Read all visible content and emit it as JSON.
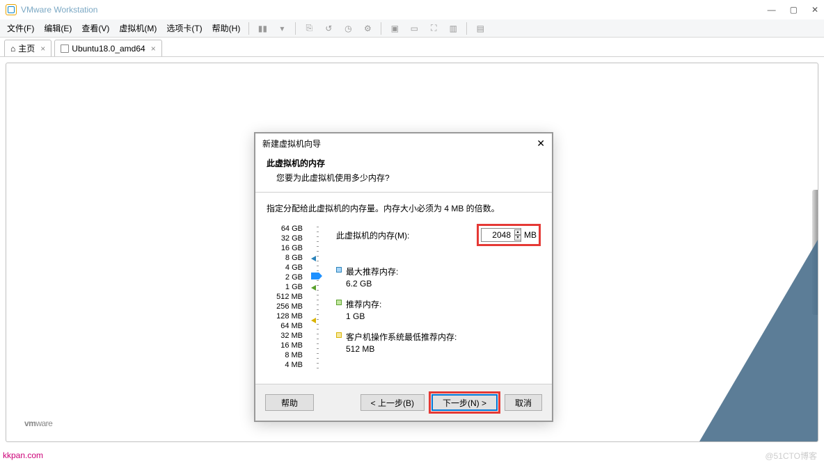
{
  "window": {
    "title": "VMware Workstation"
  },
  "win_btns": {
    "min": "—",
    "max": "▢",
    "close": "✕"
  },
  "menu": {
    "file": "文件(F)",
    "edit": "编辑(E)",
    "view": "查看(V)",
    "vm": "虚拟机(M)",
    "tabs": "选项卡(T)",
    "help": "帮助(H)"
  },
  "tabs": {
    "home": "主页",
    "vm": "Ubuntu18.0_amd64"
  },
  "watermark": {
    "vm": "vm",
    "ware": "ware"
  },
  "footer": {
    "url": "kkpan.com",
    "brand": "@51CTO博客"
  },
  "dialog": {
    "title": "新建虚拟机向导",
    "header_title": "此虚拟机的内存",
    "header_sub": "您要为此虚拟机使用多少内存?",
    "hint": "指定分配给此虚拟机的内存量。内存大小必须为 4 MB 的倍数。",
    "mem_label": "此虚拟机的内存(M):",
    "mem_value": "2048",
    "mem_unit": "MB",
    "scale": [
      "64 GB",
      "32 GB",
      "16 GB",
      "8 GB",
      "4 GB",
      "2 GB",
      "1 GB",
      "512 MB",
      "256 MB",
      "128 MB",
      "64 MB",
      "32 MB",
      "16 MB",
      "8 MB",
      "4 MB"
    ],
    "rec_max_label": "最大推荐内存:",
    "rec_max_val": "6.2 GB",
    "rec_label": "推荐内存:",
    "rec_val": "1 GB",
    "rec_min_label": "客户机操作系统最低推荐内存:",
    "rec_min_val": "512 MB",
    "btn_help": "帮助",
    "btn_back": "< 上一步(B)",
    "btn_next": "下一步(N) >",
    "btn_cancel": "取消"
  }
}
